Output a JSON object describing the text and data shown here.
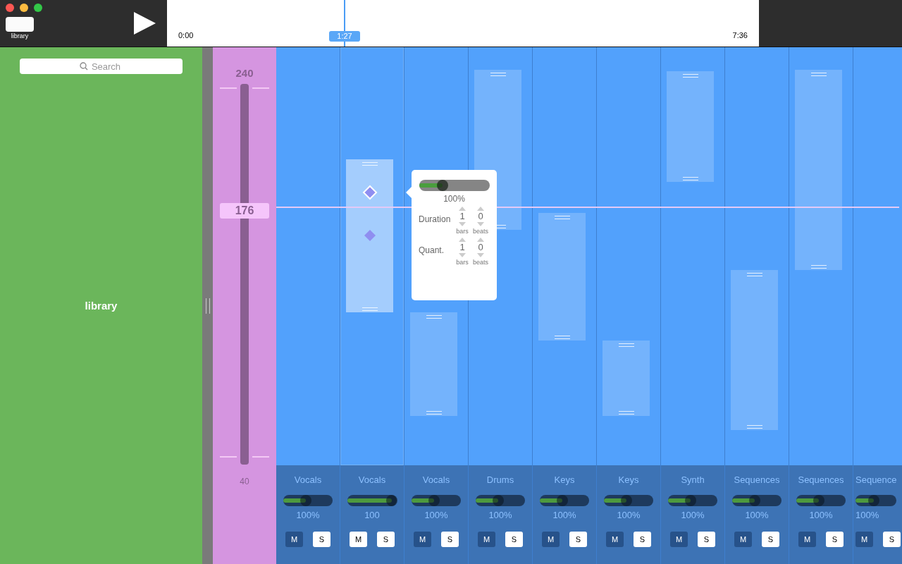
{
  "toolbar": {
    "library_button": {
      "label": "library"
    },
    "timeline": {
      "start": "0:00",
      "end": "7:36",
      "playhead": {
        "time": "1:27",
        "level": 0.3
      }
    }
  },
  "sidebar": {
    "search": {
      "placeholder": "Search"
    },
    "title": "library"
  },
  "tempo": {
    "max": "240",
    "value": "176",
    "min": "40",
    "level": 0.68
  },
  "lanes": [
    {
      "name": "Vocals",
      "volume": "100%",
      "level": 0.45,
      "mute_label": "M",
      "solo_label": "S",
      "muted": false,
      "soloed": false,
      "selected": false
    },
    {
      "name": "Vocals",
      "volume": "100",
      "level": 0.9,
      "mute_label": "M",
      "solo_label": "S",
      "muted": true,
      "soloed": false,
      "selected": true
    },
    {
      "name": "Vocals",
      "volume": "100%",
      "level": 0.45,
      "mute_label": "M",
      "solo_label": "S",
      "muted": false,
      "soloed": false,
      "selected": false
    },
    {
      "name": "Drums",
      "volume": "100%",
      "level": 0.45,
      "mute_label": "M",
      "solo_label": "S",
      "muted": false,
      "soloed": false,
      "selected": false
    },
    {
      "name": "Keys",
      "volume": "100%",
      "level": 0.45,
      "mute_label": "M",
      "solo_label": "S",
      "muted": false,
      "soloed": false,
      "selected": false
    },
    {
      "name": "Keys",
      "volume": "100%",
      "level": 0.45,
      "mute_label": "M",
      "solo_label": "S",
      "muted": false,
      "soloed": false,
      "selected": false
    },
    {
      "name": "Synth",
      "volume": "100%",
      "level": 0.45,
      "mute_label": "M",
      "solo_label": "S",
      "muted": false,
      "soloed": false,
      "selected": false
    },
    {
      "name": "Sequences",
      "volume": "100%",
      "level": 0.45,
      "mute_label": "M",
      "solo_label": "S",
      "muted": false,
      "soloed": false,
      "selected": false
    },
    {
      "name": "Sequences",
      "volume": "100%",
      "level": 0.45,
      "mute_label": "M",
      "solo_label": "S",
      "muted": false,
      "soloed": false,
      "selected": false
    },
    {
      "name": "Sequence",
      "volume": "100%",
      "level": 0.45,
      "mute_label": "M",
      "solo_label": "S",
      "muted": false,
      "soloed": false,
      "selected": false
    }
  ],
  "popover": {
    "level": 0.33,
    "reading": "100%",
    "rows": [
      {
        "label": "Duration",
        "bars": "1",
        "beats": "0",
        "bars_unit": "bars",
        "beats_unit": "beats"
      },
      {
        "label": "Quant.",
        "bars": "1",
        "beats": "0",
        "bars_unit": "bars",
        "beats_unit": "beats"
      }
    ]
  }
}
